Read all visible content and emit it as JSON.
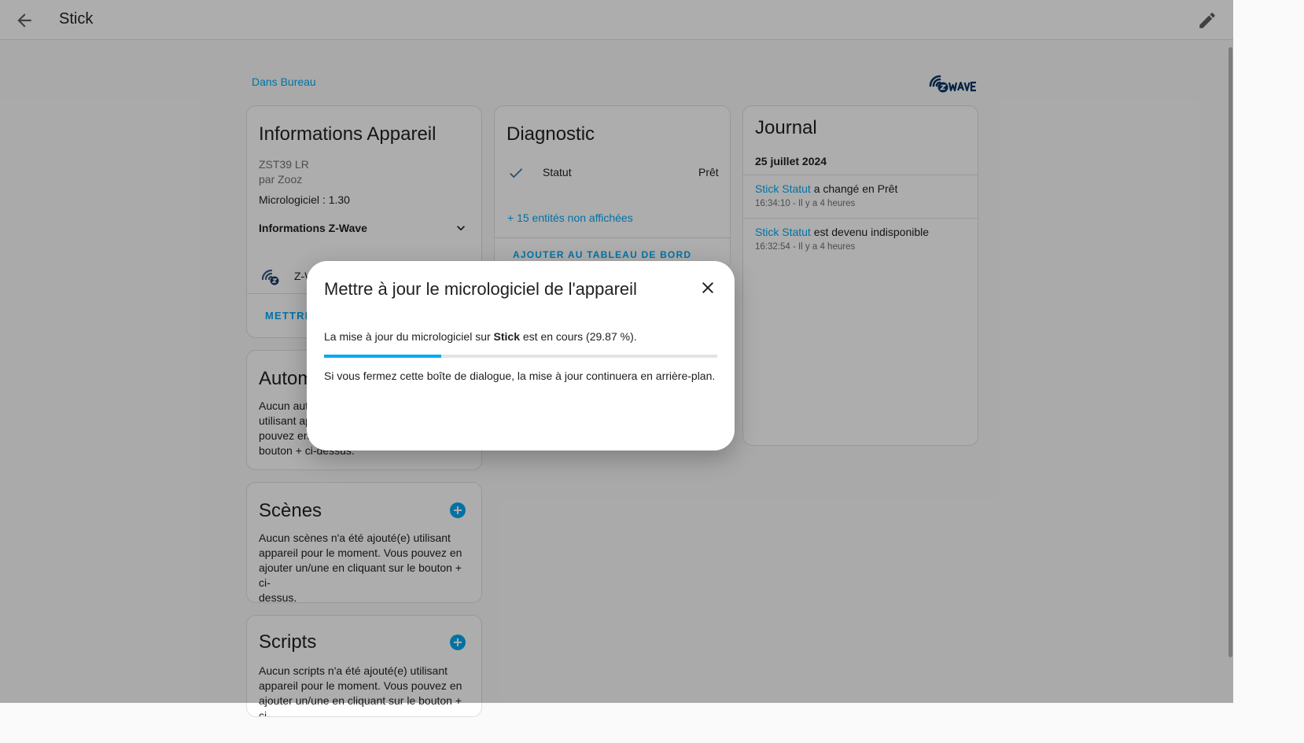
{
  "topbar": {
    "title": "Stick"
  },
  "area_link": "Dans Bureau",
  "device_info": {
    "title": "Informations Appareil",
    "model": "ZST39 LR",
    "manufacturer": "par Zooz",
    "firmware": "Micrologiciel : 1.30",
    "zwave_section": "Informations Z-Wave",
    "zwave_row_label": "Z-W",
    "action": "METTRE"
  },
  "automations": {
    "title": "Autom",
    "text_lines": [
      "Aucun aut",
      "utilisant ap",
      "pouvez en",
      "bouton + ci-dessus."
    ]
  },
  "scenes": {
    "title": "Scènes",
    "text_lines": [
      "Aucun scènes n'a été ajouté(e) utilisant",
      "appareil pour le moment. Vous pouvez en",
      "ajouter un/une en cliquant sur le bouton + ci-",
      "dessus."
    ]
  },
  "scripts": {
    "title": "Scripts",
    "text_lines": [
      "Aucun scripts n'a été ajouté(e) utilisant",
      "appareil pour le moment. Vous pouvez en",
      "ajouter un/une en cliquant sur le bouton + ci-"
    ]
  },
  "diagnostic": {
    "title": "Diagnostic",
    "entity_name": "Statut",
    "entity_state": "Prêt",
    "hidden_entities": "+ 15 entités non affichées",
    "action": "AJOUTER AU TABLEAU DE BORD"
  },
  "journal": {
    "title": "Journal",
    "date": "25 juillet 2024",
    "entries": [
      {
        "entity": "Stick Statut",
        "message": " a changé en Prêt",
        "time": "16:34:10 - Il y a 4 heures"
      },
      {
        "entity": "Stick Statut",
        "message": " est devenu indisponible",
        "time": "16:32:54 - Il y a 4 heures"
      }
    ]
  },
  "dialog": {
    "title": "Mettre à jour le micrologiciel de l'appareil",
    "text_before": "La mise à jour du micrologiciel sur ",
    "device_name": "Stick",
    "text_after": " est en cours (29.87 %).",
    "progress_percent": 29.87,
    "note": "Si vous fermez cette boîte de dialogue, la mise à jour continuera en arrière-plan."
  },
  "icons": {
    "back": "arrow-left-icon",
    "edit": "pencil-icon",
    "logo": "zwave-logo",
    "expand": "chevron-down-icon",
    "zwave": "zwave-icon",
    "status": "check-icon",
    "add": "plus-circle-icon",
    "close": "close-icon"
  },
  "colors": {
    "accent": "#03a9f4",
    "logo": "#0a3563"
  }
}
